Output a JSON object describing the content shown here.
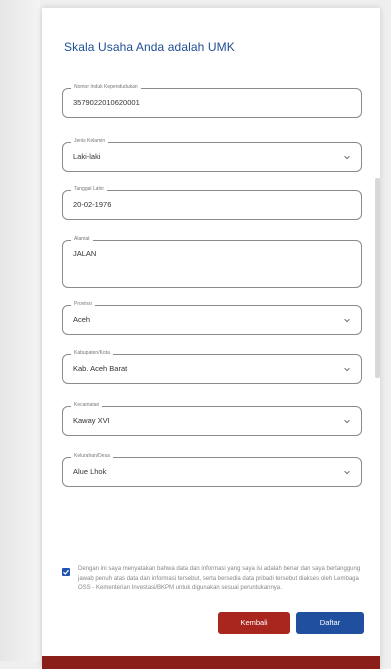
{
  "title": "Skala Usaha Anda adalah UMK",
  "fields": [
    {
      "label": "Nomor Induk Kependudukan",
      "value": "3579022010620001",
      "type": "text"
    },
    {
      "label": "Jenis Kelamin",
      "value": "Laki-laki",
      "type": "select"
    },
    {
      "label": "Tanggal Lahir",
      "value": "20-02-1976",
      "type": "text"
    },
    {
      "label": "Alamat",
      "value": "JALAN",
      "type": "textarea"
    },
    {
      "label": "Provinsi",
      "value": "Aceh",
      "type": "select"
    },
    {
      "label": "Kabupaten/Kota",
      "value": "Kab. Aceh Barat",
      "type": "select"
    },
    {
      "label": "Kecamatan",
      "value": "Kaway XVI",
      "type": "select"
    },
    {
      "label": "Kelurahan/Desa",
      "value": "Alue Lhok",
      "type": "select"
    }
  ],
  "consent": {
    "checked": true,
    "text": "Dengan ini saya menyatakan bahwa data dan informasi yang saya isi adalah benar dan saya bertanggung jawab penuh atas data dan informasi tersebut, serta bersedia data pribadi tersebut diakses oleh Lembaga OSS - Kementerian Investasi/BKPM untuk digunakan sesuai peruntukannya."
  },
  "buttons": {
    "back": "Kembali",
    "register": "Daftar"
  },
  "colors": {
    "primary": "#1f4f9e",
    "danger": "#a8261e",
    "accent_bar": "#8a1f1a"
  }
}
